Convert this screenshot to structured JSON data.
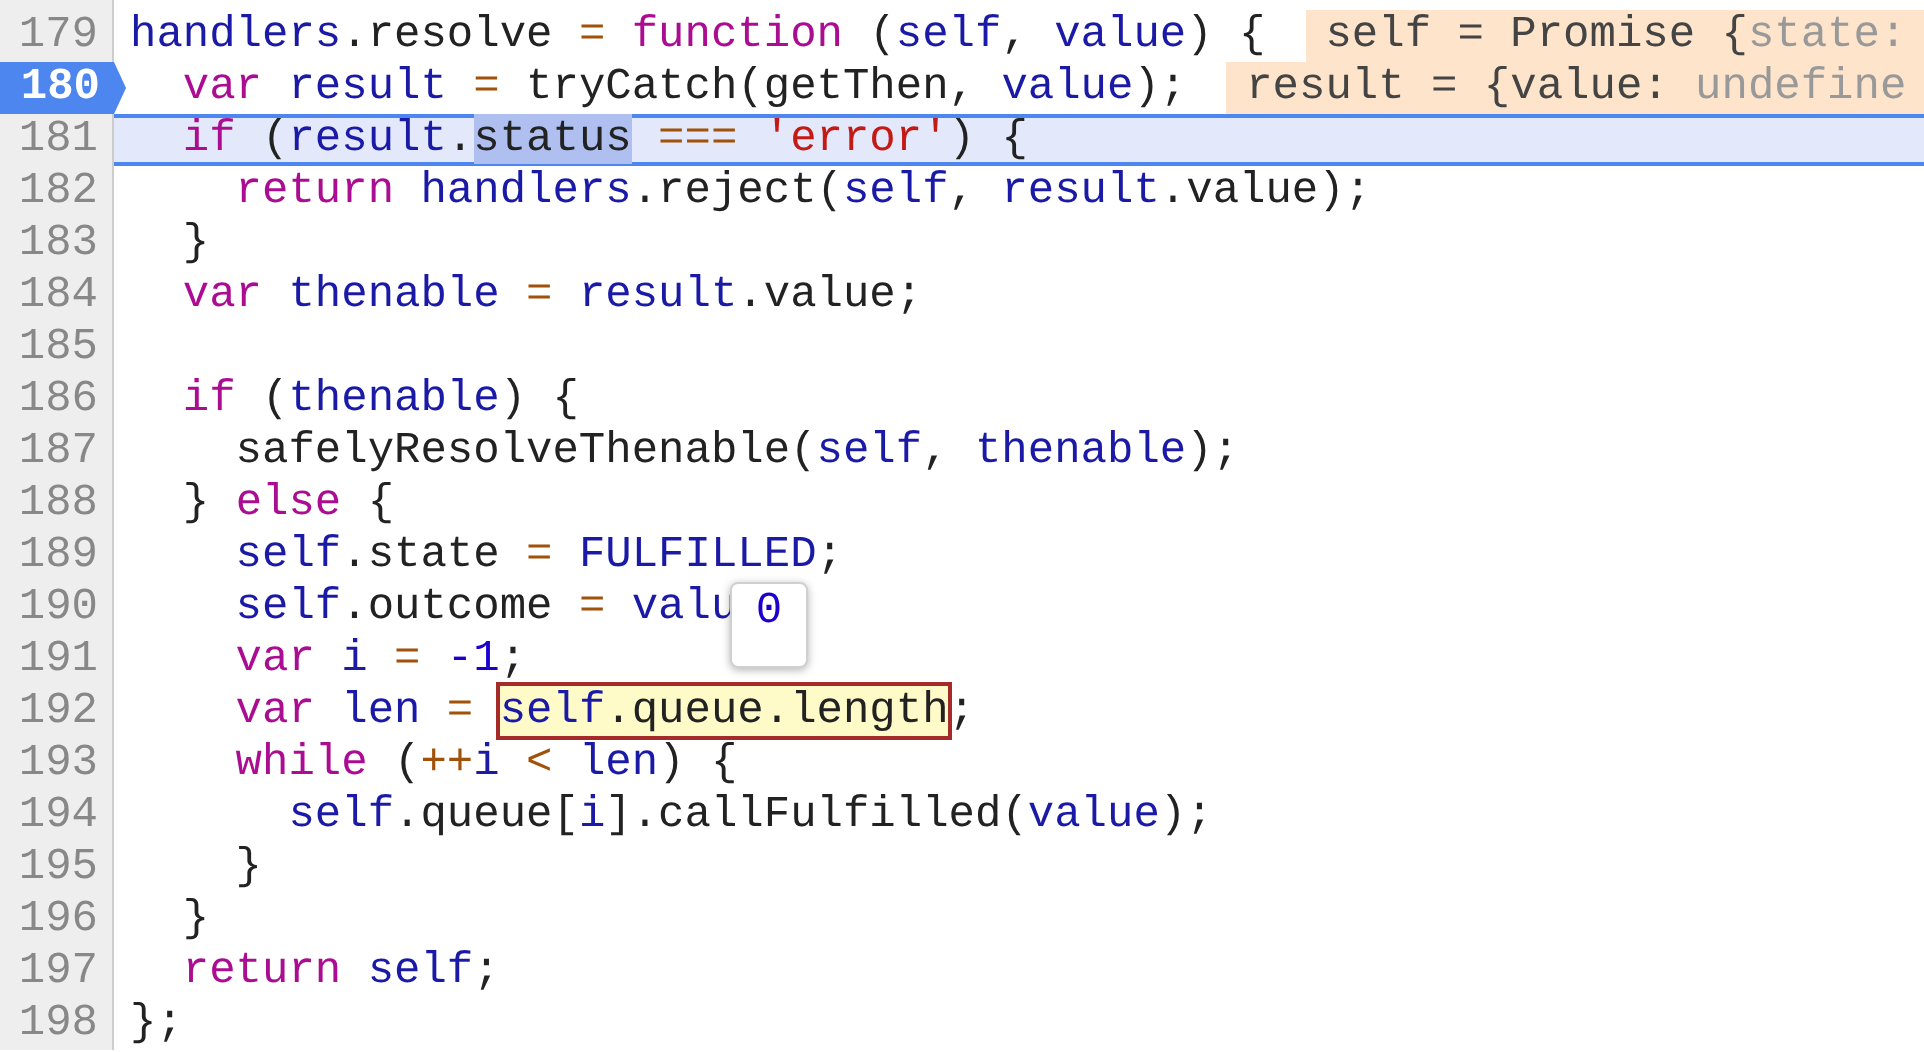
{
  "editor": {
    "lines": [
      {
        "number": "179",
        "paused": false,
        "focused": false,
        "tokens": [
          {
            "text": "handlers",
            "kind": "var"
          },
          {
            "text": ".resolve ",
            "kind": "plain"
          },
          {
            "text": "=",
            "kind": "op"
          },
          {
            "text": " function",
            "kind": "keyword"
          },
          {
            "text": " (",
            "kind": "plain"
          },
          {
            "text": "self",
            "kind": "var"
          },
          {
            "text": ", ",
            "kind": "plain"
          },
          {
            "text": "value",
            "kind": "var"
          },
          {
            "text": ") {",
            "kind": "plain"
          }
        ],
        "inline_value": [
          {
            "text": "self = Promise {",
            "kind": "name"
          },
          {
            "text": "state:",
            "kind": "dim"
          }
        ]
      },
      {
        "number": "180",
        "paused": true,
        "focused": false,
        "tokens": [
          {
            "text": "  var",
            "kind": "keyword"
          },
          {
            "text": " result",
            "kind": "var"
          },
          {
            "text": " =",
            "kind": "op"
          },
          {
            "text": " tryCatch(getThen, ",
            "kind": "plain"
          },
          {
            "text": "value",
            "kind": "var"
          },
          {
            "text": ");",
            "kind": "plain"
          }
        ],
        "inline_value": [
          {
            "text": "result = {value: ",
            "kind": "name"
          },
          {
            "text": "undefine",
            "kind": "dim"
          }
        ]
      },
      {
        "number": "181",
        "paused": false,
        "focused": true,
        "tokens": [
          {
            "text": "  if",
            "kind": "keyword"
          },
          {
            "text": " (",
            "kind": "plain"
          },
          {
            "text": "result",
            "kind": "var"
          },
          {
            "text": ".",
            "kind": "plain"
          },
          {
            "text": "status",
            "kind": "selection"
          },
          {
            "text": " ===",
            "kind": "op"
          },
          {
            "text": " 'error'",
            "kind": "string"
          },
          {
            "text": ") {",
            "kind": "plain"
          }
        ]
      },
      {
        "number": "182",
        "paused": false,
        "focused": false,
        "tokens": [
          {
            "text": "    return",
            "kind": "keyword"
          },
          {
            "text": " handlers",
            "kind": "var"
          },
          {
            "text": ".reject(",
            "kind": "plain"
          },
          {
            "text": "self",
            "kind": "var"
          },
          {
            "text": ", ",
            "kind": "plain"
          },
          {
            "text": "result",
            "kind": "var"
          },
          {
            "text": ".value);",
            "kind": "plain"
          }
        ]
      },
      {
        "number": "183",
        "paused": false,
        "focused": false,
        "tokens": [
          {
            "text": "  }",
            "kind": "plain"
          }
        ]
      },
      {
        "number": "184",
        "paused": false,
        "focused": false,
        "tokens": [
          {
            "text": "  var",
            "kind": "keyword"
          },
          {
            "text": " thenable",
            "kind": "var"
          },
          {
            "text": " =",
            "kind": "op"
          },
          {
            "text": " result",
            "kind": "var"
          },
          {
            "text": ".value;",
            "kind": "plain"
          }
        ]
      },
      {
        "number": "185",
        "paused": false,
        "focused": false
      },
      {
        "number": "186",
        "paused": false,
        "focused": false,
        "tokens": [
          {
            "text": "  if",
            "kind": "keyword"
          },
          {
            "text": " (",
            "kind": "plain"
          },
          {
            "text": "thenable",
            "kind": "var"
          },
          {
            "text": ") {",
            "kind": "plain"
          }
        ]
      },
      {
        "number": "187",
        "paused": false,
        "focused": false,
        "tokens": [
          {
            "text": "    safelyResolveThenable(",
            "kind": "plain"
          },
          {
            "text": "self",
            "kind": "var"
          },
          {
            "text": ", ",
            "kind": "plain"
          },
          {
            "text": "thenable",
            "kind": "var"
          },
          {
            "text": ");",
            "kind": "plain"
          }
        ]
      },
      {
        "number": "188",
        "paused": false,
        "focused": false,
        "tokens": [
          {
            "text": "  } ",
            "kind": "plain"
          },
          {
            "text": "else",
            "kind": "keyword"
          },
          {
            "text": " {",
            "kind": "plain"
          }
        ]
      },
      {
        "number": "189",
        "paused": false,
        "focused": false,
        "tokens": [
          {
            "text": "    self",
            "kind": "var"
          },
          {
            "text": ".state ",
            "kind": "plain"
          },
          {
            "text": "=",
            "kind": "op"
          },
          {
            "text": " FULFILLED",
            "kind": "var"
          },
          {
            "text": ";",
            "kind": "plain"
          }
        ]
      },
      {
        "number": "190",
        "paused": false,
        "focused": false,
        "tokens": [
          {
            "text": "    self",
            "kind": "var"
          },
          {
            "text": ".outcome ",
            "kind": "plain"
          },
          {
            "text": "=",
            "kind": "op"
          },
          {
            "text": " valu",
            "kind": "var"
          }
        ],
        "popover": "0"
      },
      {
        "number": "191",
        "paused": false,
        "focused": false,
        "tokens": [
          {
            "text": "    var",
            "kind": "keyword"
          },
          {
            "text": " i",
            "kind": "var"
          },
          {
            "text": " =",
            "kind": "op"
          },
          {
            "text": " -1",
            "kind": "number"
          },
          {
            "text": ";",
            "kind": "plain"
          }
        ]
      },
      {
        "number": "192",
        "paused": false,
        "focused": false,
        "tokens": [
          {
            "text": "    var",
            "kind": "keyword"
          },
          {
            "text": " len",
            "kind": "var"
          },
          {
            "text": " = ",
            "kind": "op"
          },
          {
            "kind": "hovered",
            "tokens": [
              {
                "text": "self",
                "kind": "var"
              },
              {
                "text": ".queue.length",
                "kind": "plain"
              }
            ]
          },
          {
            "text": ";",
            "kind": "plain"
          }
        ]
      },
      {
        "number": "193",
        "paused": false,
        "focused": false,
        "tokens": [
          {
            "text": "    while",
            "kind": "keyword"
          },
          {
            "text": " (",
            "kind": "plain"
          },
          {
            "text": "++",
            "kind": "op"
          },
          {
            "text": "i",
            "kind": "var"
          },
          {
            "text": " <",
            "kind": "op"
          },
          {
            "text": " len",
            "kind": "var"
          },
          {
            "text": ") {",
            "kind": "plain"
          }
        ]
      },
      {
        "number": "194",
        "paused": false,
        "focused": false,
        "tokens": [
          {
            "text": "      self",
            "kind": "var"
          },
          {
            "text": ".queue[",
            "kind": "plain"
          },
          {
            "text": "i",
            "kind": "var"
          },
          {
            "text": "].callFulfilled(",
            "kind": "plain"
          },
          {
            "text": "value",
            "kind": "var"
          },
          {
            "text": ");",
            "kind": "plain"
          }
        ]
      },
      {
        "number": "195",
        "paused": false,
        "focused": false,
        "tokens": [
          {
            "text": "    }",
            "kind": "plain"
          }
        ]
      },
      {
        "number": "196",
        "paused": false,
        "focused": false,
        "tokens": [
          {
            "text": "  }",
            "kind": "plain"
          }
        ]
      },
      {
        "number": "197",
        "paused": false,
        "focused": false,
        "tokens": [
          {
            "text": "  return",
            "kind": "keyword"
          },
          {
            "text": " self",
            "kind": "var"
          },
          {
            "text": ";",
            "kind": "plain"
          }
        ]
      },
      {
        "number": "198",
        "paused": false,
        "focused": false,
        "tokens": [
          {
            "text": "};",
            "kind": "plain"
          }
        ]
      }
    ]
  }
}
